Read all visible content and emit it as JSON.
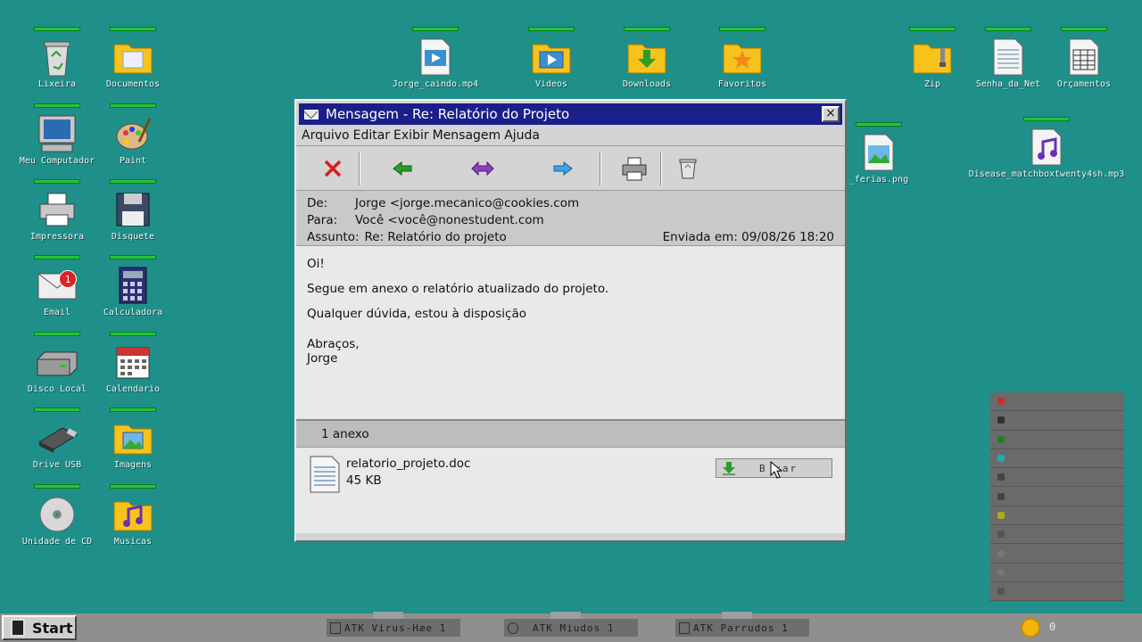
{
  "desktop_icons": [
    {
      "id": "lixeira",
      "label": "Lixeira"
    },
    {
      "id": "documentos",
      "label": "Documentos"
    },
    {
      "id": "meu-computador",
      "label": "Meu Computador"
    },
    {
      "id": "paint",
      "label": "Paint"
    },
    {
      "id": "impressora",
      "label": "Impressora"
    },
    {
      "id": "disquete",
      "label": "Disquete"
    },
    {
      "id": "email",
      "label": "Email"
    },
    {
      "id": "calculadora",
      "label": "Calculadora"
    },
    {
      "id": "disco-local",
      "label": "Disco Local"
    },
    {
      "id": "calendario",
      "label": "Calendario"
    },
    {
      "id": "drive-usb",
      "label": "Drive USB"
    },
    {
      "id": "imagens",
      "label": "Imagens"
    },
    {
      "id": "unidade-cd",
      "label": "Unidade de CD"
    },
    {
      "id": "musicas",
      "label": "Musicas"
    },
    {
      "id": "jorge-caindo",
      "label": "Jorge_caindo.mp4"
    },
    {
      "id": "videos",
      "label": "Videos"
    },
    {
      "id": "downloads",
      "label": "Downloads"
    },
    {
      "id": "favoritos",
      "label": "Favoritos"
    },
    {
      "id": "ferias",
      "label": "_ferias.png"
    },
    {
      "id": "zip",
      "label": "Zip"
    },
    {
      "id": "senha-net",
      "label": "Senha_da_Net"
    },
    {
      "id": "orcamentos",
      "label": "Orçamentos"
    },
    {
      "id": "disease-mp3",
      "label": "Disease_matchboxtwenty4sh.mp3"
    }
  ],
  "email_badge": "1",
  "window": {
    "title": "Mensagem - Re: Relatório do Projeto",
    "close": "×",
    "menu": [
      "Arquivo",
      "Editar",
      "Exibir",
      "Mensagem",
      "Ajuda"
    ],
    "toolbar": [
      {
        "name": "delete",
        "icon": "x-icon"
      },
      {
        "name": "reply",
        "icon": "arrow-left-icon"
      },
      {
        "name": "reply-all",
        "icon": "double-arrow-icon"
      },
      {
        "name": "forward",
        "icon": "arrow-right-icon"
      },
      {
        "name": "print",
        "icon": "printer-icon"
      },
      {
        "name": "trash",
        "icon": "trash-icon"
      }
    ],
    "headers": {
      "from_label": "De:",
      "from_value": "Jorge <jorge.mecanico@cookies.com",
      "to_label": "Para:",
      "to_value": "Você <você@nonestudent.com",
      "subject_label": "Assunto:",
      "subject_value": "Re: Relatório do projeto",
      "sent": "Enviada em: 09/08/26 18:20"
    },
    "body": {
      "greeting": "Oi!",
      "line1": "Segue em anexo o relatório atualizado do projeto.",
      "line2": "Qualquer dúvida, estou à disposição",
      "closing1": "Abraços,",
      "closing2": "Jorge"
    },
    "attachments": {
      "count_label": "1 anexo",
      "file_name": "relatorio_projeto.doc",
      "file_size": "45 KB",
      "download_label": "B  xar"
    }
  },
  "taskbar": {
    "start_label": "Start",
    "tasks": [
      "ATK Virus-Hæe 1",
      "ATK Miudos 1",
      "ATK Parrudos 1"
    ],
    "coin_count": "0"
  },
  "colors": {
    "desktop": "#1f8f8a",
    "titlebar": "#1b1f8a",
    "health": "#22c43b"
  }
}
